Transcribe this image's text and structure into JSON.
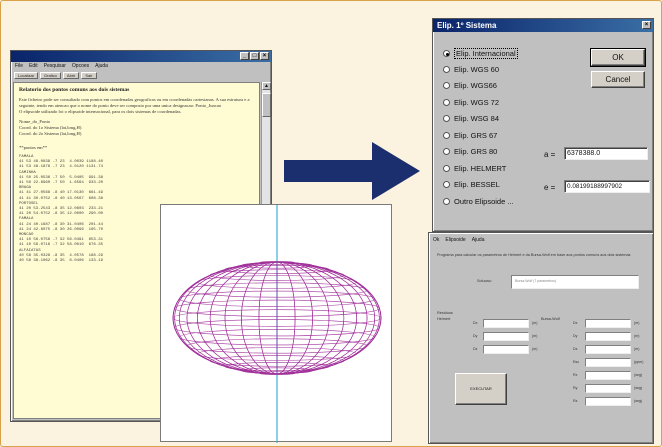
{
  "editor": {
    "title": "",
    "menu": [
      "File",
      "Edit",
      "Pesquisar",
      "Opcoes",
      "Ajuda"
    ],
    "toolbar": [
      "Localizar",
      "Grafico",
      "Abrir",
      "Sair"
    ],
    "heading": "Relatorio dos pontos comuns aos dois sistemas",
    "paragraph1": "Este ficheiro pode ser consultado com pontos em coordenadas geograficas ou em coordenadas cartesianas. A sua estrutura e a seguinte, tendo em atencao que o nome do ponto deve ser composto por uma unica designacao: Ponto_Juncao",
    "paragraph2": "O elipsoide utilizado foi o elipsoide internacional, para os dois sistemas de coordenadas.",
    "template_lines": [
      "Nome_do_Ponto",
      "Coord. do 1o Sistema (lat,long,H)",
      "Coord. do 2o Sistema (lat,long,H)"
    ],
    "marker": "**pontos em**",
    "data_lines": [
      "FAMALA",
      "41 53 48.0838 -7 23  4.0039 1188.40",
      "41 53 48.1876 -7 23  4.0120 1131.74",
      "CAMINHA",
      "41 50 25.0536 -7 50  5.0405  991.38",
      "41 50 22.6960 -7 50  1.6564  933.20",
      "BRAGA",
      "41 41 27.0568 -8 40 17.0130  661.49",
      "41 41 30.0752 -8 40 13.0567  608.38",
      "PORTOSEL",
      "41 20 53.2543 -8 35 12.0603  233.21",
      "41 20 54.0752 -8 35 12.0000  290.00",
      "FAMALA",
      "41 24 40.1687 -8 30 31.0406  201.44",
      "41 24 42.6075 -8 30 26.0096  165.70",
      "MONCAO",
      "41 10 56.0756 -7 32 56.0491  653.31",
      "41 10 56.0716 -7 32 58.0010  676.35",
      "ALFAIATAS",
      "40 58 35.0329 -8 35  4.0578  188.29",
      "40 58 38.1062 -8 35  8.0406  133.19"
    ]
  },
  "dialog1": {
    "title": "Elip. 1º Sistema",
    "options": [
      "Elip. Internacional",
      "Elip. WGS 60",
      "Elip. WGS66",
      "Elip. WGS 72",
      "Elip. WSG 84",
      "Elip. GRS 67",
      "Elip. GRS 80",
      "Elip. HELMERT",
      "Elip. BESSEL",
      "Outro Elipsoide ..."
    ],
    "selected_index": 0,
    "ok_label": "OK",
    "cancel_label": "Cancel",
    "a_label": "a =",
    "a_value": "6378388.0",
    "e_label": "e =",
    "e_value": "0.08199188997902"
  },
  "dialog2": {
    "menu": [
      "Ok",
      "Elipsoide",
      "Ajuda"
    ],
    "description": "Programa para calcular os parametros de Helmert e da Bursa-Wolf em base aos pontos comuns aos dois sistemas",
    "solution_label": "Solucao:",
    "solution_value": "Bursa-Wolf   (7 parametros)",
    "residuals_label": "Residuos",
    "residuals_sub": "Helmert",
    "left_labels": [
      "Dx",
      "Dy",
      "Dz"
    ],
    "left_units": [
      "(m)",
      "(m)",
      "(m)"
    ],
    "right_head": "Bursa-Wolf",
    "right_labels": [
      "Dx",
      "Dy",
      "Dz",
      "Esc",
      "Rx",
      "Ry",
      "Rz"
    ],
    "right_units": [
      "(m)",
      "(m)",
      "(m)",
      "(ppm)",
      "(seg)",
      "(seg)",
      "(seg)"
    ],
    "execute_label": "EXECUTAR"
  },
  "plot": {
    "ellipsoid_color": "#a0309a",
    "axis_color": "#40b0d8"
  },
  "colors": {
    "frame": "#d8a14a",
    "arrow": "#1b2e6e",
    "titlebar": "#0a246a"
  }
}
